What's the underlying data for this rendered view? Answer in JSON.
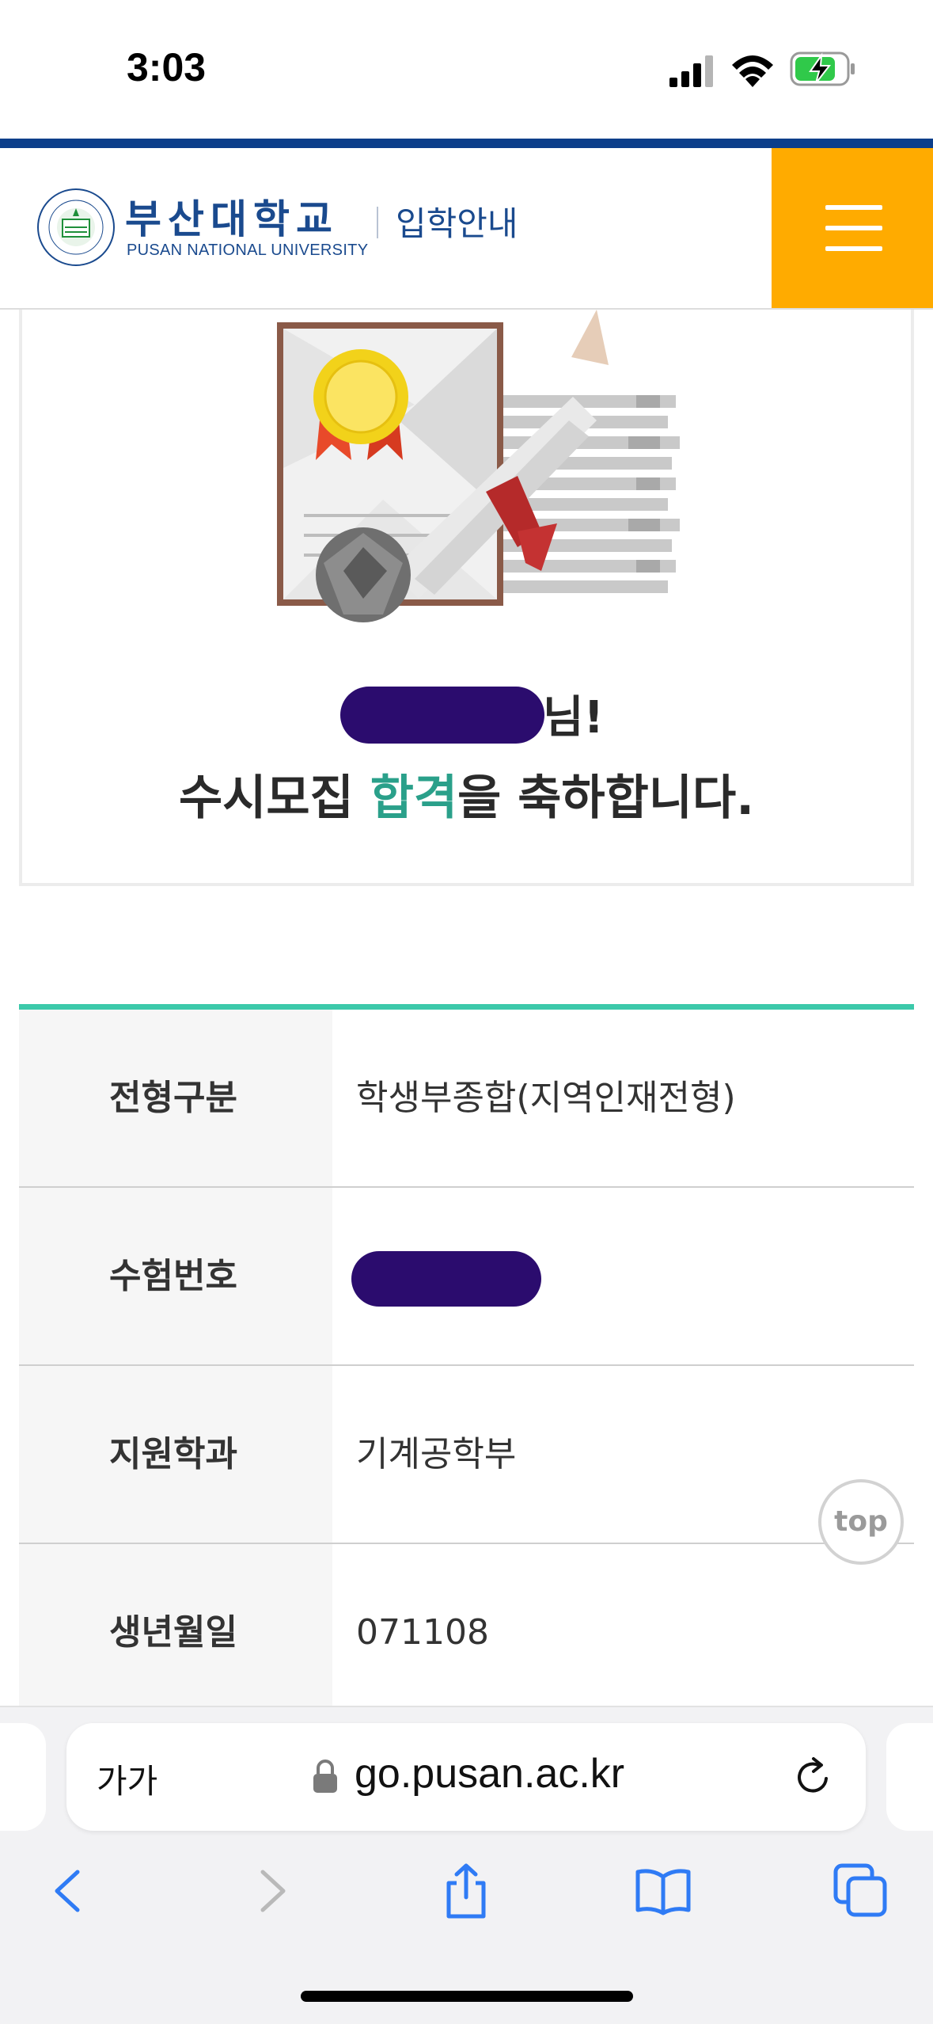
{
  "status_bar": {
    "time": "3:03"
  },
  "header": {
    "university_name_kr": "부산대학교",
    "university_name_en": "PUSAN NATIONAL UNIVERSITY",
    "section_title": "입학안내",
    "accent_color": "#ffab00",
    "brand_color": "#1a4a8e"
  },
  "result_card": {
    "name_suffix": "님!",
    "congrats_before": "수시모집 ",
    "congrats_highlight": "합격",
    "congrats_after": "을 축하합니다.",
    "highlight_color": "#2aa08a"
  },
  "info_table": {
    "rows": [
      {
        "label": "전형구분",
        "value": "학생부종합(지역인재전형)"
      },
      {
        "label": "수험번호",
        "value": ""
      },
      {
        "label": "지원학과",
        "value": "기계공학부"
      },
      {
        "label": "생년월일",
        "value": "071108"
      }
    ]
  },
  "top_button": {
    "label": "top"
  },
  "browser": {
    "text_size_label": "가가",
    "url": "go.pusan.ac.kr",
    "icons": [
      "back-icon",
      "forward-icon",
      "share-icon",
      "bookmarks-icon",
      "tabs-icon"
    ]
  }
}
